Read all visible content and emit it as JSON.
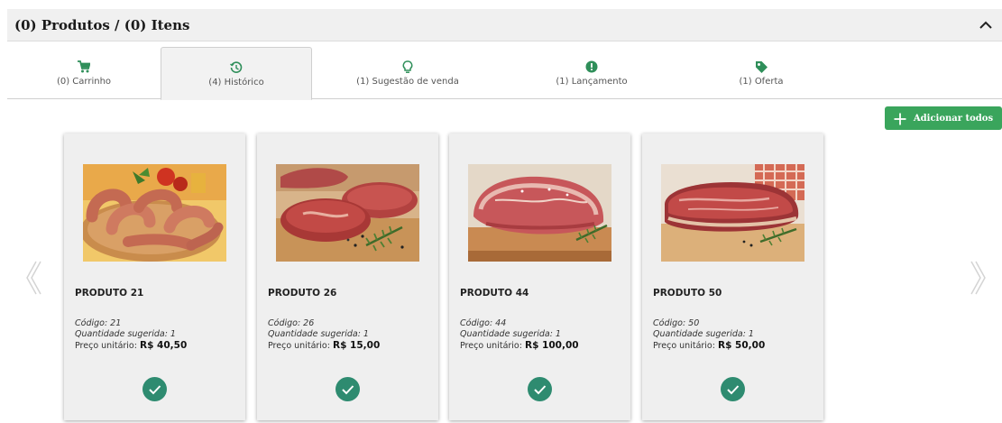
{
  "header": {
    "title": "(0) Produtos / (0) Itens"
  },
  "tabs": [
    {
      "label": "(0) Carrinho",
      "icon": "cart-icon"
    },
    {
      "label": "(4) Histórico",
      "icon": "history-icon"
    },
    {
      "label": "(1) Sugestão de venda",
      "icon": "lightbulb-icon"
    },
    {
      "label": "(1) Lançamento",
      "icon": "alert-icon"
    },
    {
      "label": "(1) Oferta",
      "icon": "tag-icon"
    }
  ],
  "add_all": {
    "label": "Adicionar todos"
  },
  "colors": {
    "accent": "#3aa55c",
    "check": "#2e8b70"
  },
  "products": [
    {
      "name": "PRODUTO 21",
      "code": "Código: 21",
      "qty": "Quantidade sugerida: 1",
      "price_label": "Preço unitário:",
      "price": "R$ 40,50"
    },
    {
      "name": "PRODUTO 26",
      "code": "Código: 26",
      "qty": "Quantidade sugerida: 1",
      "price_label": "Preço unitário:",
      "price": "R$ 15,00"
    },
    {
      "name": "PRODUTO 44",
      "code": "Código: 44",
      "qty": "Quantidade sugerida: 1",
      "price_label": "Preço unitário:",
      "price": "R$ 100,00"
    },
    {
      "name": "PRODUTO 50",
      "code": "Código: 50",
      "qty": "Quantidade sugerida: 1",
      "price_label": "Preço unitário:",
      "price": "R$ 50,00"
    }
  ]
}
